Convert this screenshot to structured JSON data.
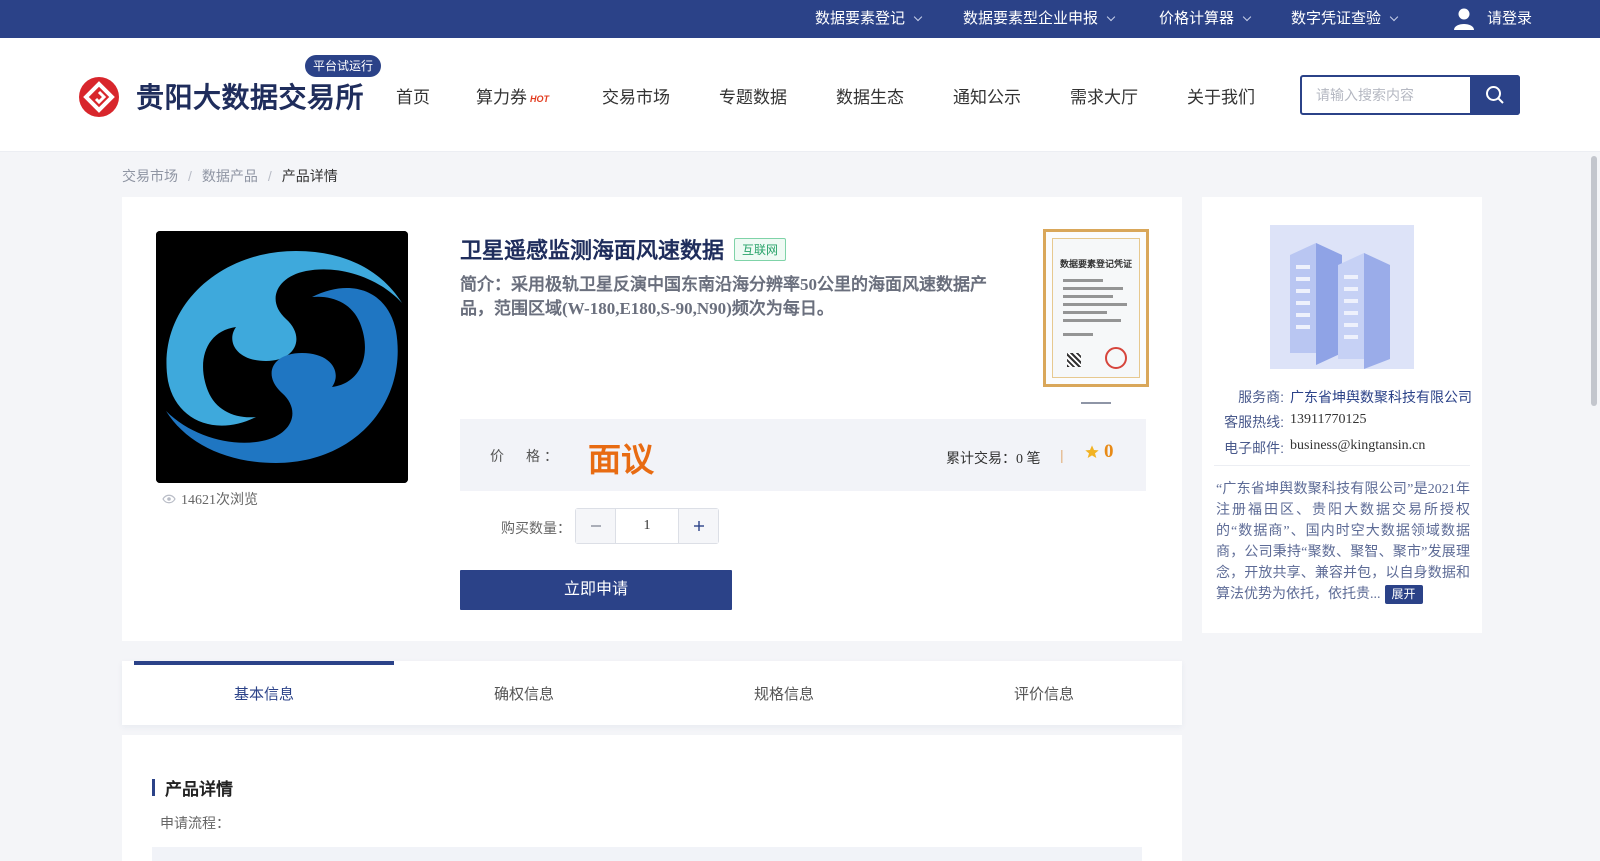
{
  "colors": {
    "brand": "#2b4288",
    "price": "#e86b12",
    "tag_green": "#29a36a"
  },
  "topbar": {
    "items": [
      {
        "label": "数据要素登记"
      },
      {
        "label": "数据要素型企业申报"
      },
      {
        "label": "价格计算器"
      },
      {
        "label": "数字凭证查验"
      }
    ],
    "login": "请登录"
  },
  "header": {
    "brand": "贵阳大数据交易所",
    "trial_badge": "平台试运行",
    "nav": [
      "首页",
      "算力券",
      "交易市场",
      "专题数据",
      "数据生态",
      "通知公示",
      "需求大厅",
      "关于我们"
    ],
    "hot_tag": "HOT",
    "search": {
      "placeholder": "请输入搜索内容",
      "value": ""
    }
  },
  "breadcrumb": [
    "交易市场",
    "数据产品",
    "产品详情"
  ],
  "product": {
    "title": "卫星遥感监测海面风速数据",
    "tag": "互联网",
    "intro": "简介：采用极轨卫星反演中国东南沿海分辨率50公里的海面风速数据产品，范围区域(W-180,E180,S-90,N90)频次为每日。",
    "views": "14621次浏览",
    "certificate_title": "数据要素登记凭证",
    "price_label": "价　格：",
    "price": "面议",
    "trade_count": "累计交易：0 笔",
    "score": "0",
    "quantity_label": "购买数量：",
    "quantity": "1",
    "apply_label": "立即申请"
  },
  "provider": {
    "rows": [
      {
        "key": "服务商:",
        "value": "广东省坤舆数聚科技有限公司"
      },
      {
        "key": "客服热线:",
        "value": "13911770125"
      },
      {
        "key": "电子邮件:",
        "value": "business@kingtansin.cn"
      }
    ],
    "description": "“广东省坤舆数聚科技有限公司”是2021年注册福田区、贵阳大数据交易所授权的“数据商”、国内时空大数据领域数据商，公司秉持“聚数、聚智、聚市”发展理念，开放共享、兼容并包，以自身数据和算法优势为依托，依托贵...",
    "expand_label": "展开"
  },
  "tabs": [
    {
      "label": "基本信息",
      "active": true
    },
    {
      "label": "确权信息",
      "active": false
    },
    {
      "label": "规格信息",
      "active": false
    },
    {
      "label": "评价信息",
      "active": false
    }
  ],
  "detail": {
    "title": "产品详情",
    "subtitle": "申请流程："
  }
}
